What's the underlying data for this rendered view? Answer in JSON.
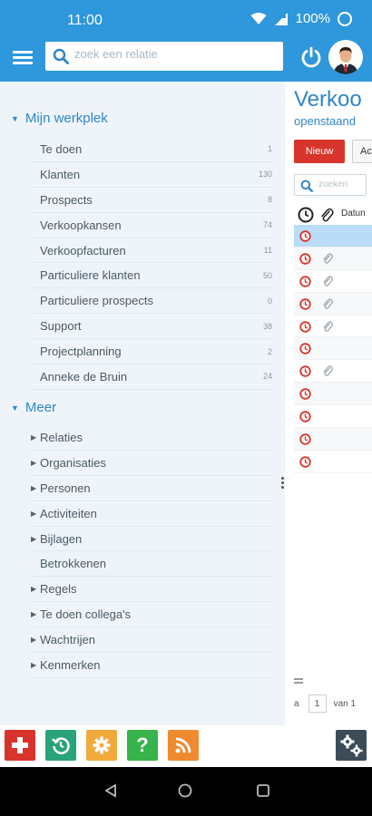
{
  "status_bar": {
    "time": "11:00",
    "battery": "100%"
  },
  "header": {
    "search_placeholder": "zoek een relatie"
  },
  "sidebar": {
    "workplace": {
      "title": "Mijn werkplek",
      "items": [
        {
          "label": "Te doen",
          "count": "1"
        },
        {
          "label": "Klanten",
          "count": "130"
        },
        {
          "label": "Prospects",
          "count": "8"
        },
        {
          "label": "Verkoopkansen",
          "count": "74"
        },
        {
          "label": "Verkoopfacturen",
          "count": "11"
        },
        {
          "label": "Particuliere klanten",
          "count": "50"
        },
        {
          "label": "Particuliere prospects",
          "count": "0"
        },
        {
          "label": "Support",
          "count": "38"
        },
        {
          "label": "Projectplanning",
          "count": "2"
        },
        {
          "label": "Anneke de Bruin",
          "count": "24"
        }
      ]
    },
    "more": {
      "title": "Meer",
      "items": [
        {
          "label": "Relaties",
          "expandable": true
        },
        {
          "label": "Organisaties",
          "expandable": true
        },
        {
          "label": "Personen",
          "expandable": true
        },
        {
          "label": "Activiteiten",
          "expandable": true
        },
        {
          "label": "Bijlagen",
          "expandable": true
        },
        {
          "label": "Betrokkenen",
          "expandable": false
        },
        {
          "label": "Regels",
          "expandable": true
        },
        {
          "label": "Te doen collega's",
          "expandable": true
        },
        {
          "label": "Wachtrijen",
          "expandable": true
        },
        {
          "label": "Kenmerken",
          "expandable": true
        }
      ]
    }
  },
  "panel": {
    "title": "Verkoo",
    "subtitle": "openstaand",
    "new_button": "Nieuw",
    "second_button": "Ac",
    "search_placeholder": "zoeken",
    "col_date": "Datun",
    "rows": [
      {
        "selected": true,
        "attachment": false
      },
      {
        "selected": false,
        "attachment": true
      },
      {
        "selected": false,
        "attachment": true
      },
      {
        "selected": false,
        "attachment": true
      },
      {
        "selected": false,
        "attachment": true
      },
      {
        "selected": false,
        "attachment": false
      },
      {
        "selected": false,
        "attachment": true
      },
      {
        "selected": false,
        "attachment": false
      },
      {
        "selected": false,
        "attachment": false
      },
      {
        "selected": false,
        "attachment": false
      },
      {
        "selected": false,
        "attachment": false
      }
    ],
    "pager": {
      "prefix": "a",
      "page": "1",
      "suffix": "van 1"
    }
  },
  "toolbar": {
    "buttons": [
      "add-icon",
      "history-icon",
      "gear-icon",
      "help-icon",
      "rss-icon"
    ],
    "help_glyph": "?",
    "settings_icon": "settings-gears-icon"
  },
  "colors": {
    "brand_blue": "#2f97dc",
    "link_blue": "#2f86c9",
    "danger_red": "#d9342b",
    "sidebar_bg": "#eef4fa"
  }
}
